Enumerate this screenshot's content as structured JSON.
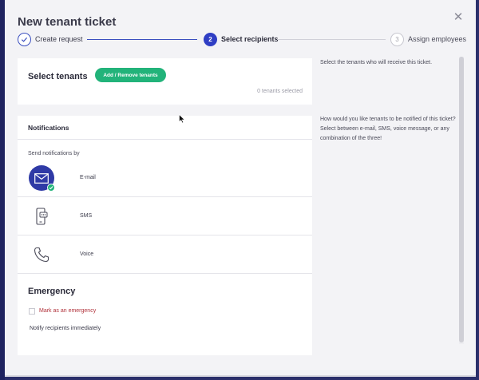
{
  "modal": {
    "title": "New tenant ticket",
    "close_icon": "close-icon"
  },
  "stepper": {
    "steps": [
      {
        "label": "Create request",
        "state": "completed",
        "number": ""
      },
      {
        "label": "Select recipients",
        "state": "active",
        "number": "2"
      },
      {
        "label": "Assign employees",
        "state": "pending",
        "number": "3"
      }
    ]
  },
  "select_tenants": {
    "title": "Select tenants",
    "add_button": "Add / Remove tenants",
    "count_text": "0 tenants selected",
    "hint": "Select the tenants who will receive this ticket."
  },
  "notifications": {
    "header": "Notifications",
    "send_label": "Send notifications by",
    "hint": "How would you like tenants to be notified of this ticket? Select between e-mail, SMS, voice message, or any combination of the three!",
    "channels": [
      {
        "label": "E-mail",
        "icon": "email-icon",
        "selected": true
      },
      {
        "label": "SMS",
        "icon": "sms-phone-icon",
        "selected": false
      },
      {
        "label": "Voice",
        "icon": "phone-handset-icon",
        "selected": false
      }
    ]
  },
  "emergency": {
    "title": "Emergency",
    "checkbox_label": "Mark as an emergency",
    "checked": false,
    "notify_text": "Notify recipients immediately"
  },
  "colors": {
    "primary": "#2f3ec4",
    "success": "#22b37a",
    "danger": "#b0313a",
    "backdrop": "#2b2f6b"
  }
}
